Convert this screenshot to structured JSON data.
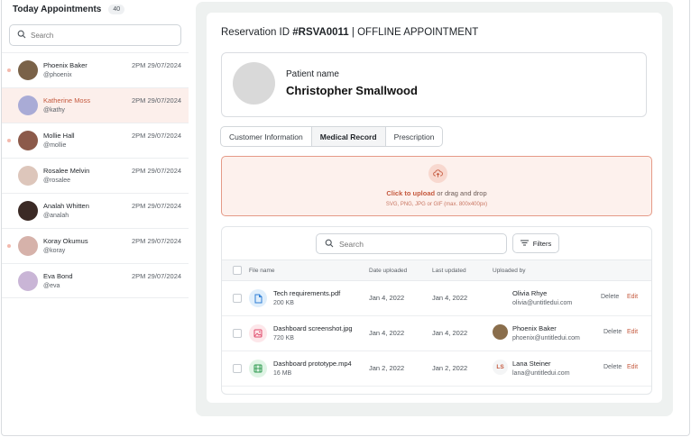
{
  "appointments_panel": {
    "title": "Today Appointments",
    "count": "40",
    "search_placeholder": "Search",
    "items": [
      {
        "name": "Phoenix Baker",
        "handle": "@phoenix",
        "time": "2PM 29/07/2024",
        "avatar_color": "#7a6248"
      },
      {
        "name": "Katherine Moss",
        "handle": "@kathy",
        "time": "2PM 29/07/2024",
        "avatar_color": "#a9abd6"
      },
      {
        "name": "Mollie Hall",
        "handle": "@mollie",
        "time": "2PM 29/07/2024",
        "avatar_color": "#8c5a4a"
      },
      {
        "name": "Rosalee Melvin",
        "handle": "@rosalee",
        "time": "2PM 29/07/2024",
        "avatar_color": "#ddc6bb"
      },
      {
        "name": "Analah Whitten",
        "handle": "@analah",
        "time": "2PM 29/07/2024",
        "avatar_color": "#3b2a25"
      },
      {
        "name": "Koray Okumus",
        "handle": "@koray",
        "time": "2PM 29/07/2024",
        "avatar_color": "#d6b2aa"
      },
      {
        "name": "Eva Bond",
        "handle": "@eva",
        "time": "2PM 29/07/2024",
        "avatar_color": "#c9b5d6"
      }
    ]
  },
  "reservation": {
    "prefix": "Reservation ID ",
    "id": "#RSVA0011",
    "suffix": " | OFFLINE APPOINTMENT"
  },
  "patient": {
    "label": "Patient name",
    "name": "Christopher Smallwood"
  },
  "tabs": [
    {
      "label": "Customer Information",
      "active": false
    },
    {
      "label": "Medical Record",
      "active": true
    },
    {
      "label": "Prescription",
      "active": false
    }
  ],
  "upload": {
    "link_text": "Click to upload",
    "rest_text": "or drag and drop",
    "hint": "SVG, PNG, JPG or GIF (max. 800x400px)",
    "icon": "upload-cloud-icon"
  },
  "files": {
    "search_placeholder": "Search",
    "filters_label": "Filters",
    "headers": {
      "file_name": "File name",
      "date_uploaded": "Date uploaded",
      "last_updated": "Last updated",
      "uploaded_by": "Uploaded by"
    },
    "rows": [
      {
        "name": "Tech requirements.pdf",
        "size": "200 KB",
        "date_uploaded": "Jan 4, 2022",
        "last_updated": "Jan 4, 2022",
        "user": "Olivia Rhye",
        "email": "olivia@untitledui.com",
        "user_initials": "",
        "icon": "file-icon",
        "icon_bg": "#dfeefb",
        "icon_color": "#2f7fd6",
        "delete": "Delete",
        "edit": "Edit"
      },
      {
        "name": "Dashboard screenshot.jpg",
        "size": "720 KB",
        "date_uploaded": "Jan 4, 2022",
        "last_updated": "Jan 4, 2022",
        "user": "Phoenix Baker",
        "email": "phoenix@untitledui.com",
        "user_initials": "",
        "icon": "image-icon",
        "icon_bg": "#fde7ea",
        "icon_color": "#e0486a",
        "delete": "Delete",
        "edit": "Edit"
      },
      {
        "name": "Dashboard prototype.mp4",
        "size": "16 MB",
        "date_uploaded": "Jan 2, 2022",
        "last_updated": "Jan 2, 2022",
        "user": "Lana Steiner",
        "email": "lana@untitledui.com",
        "user_initials": "LS",
        "icon": "video-icon",
        "icon_bg": "#dff4e5",
        "icon_color": "#2f9a50",
        "delete": "Delete",
        "edit": "Edit"
      }
    ]
  },
  "colors": {
    "accent": "#c55a3f",
    "upload_bg": "#fdf1ed",
    "upload_border": "#e59a87",
    "panel_bg": "#eef1f0"
  }
}
